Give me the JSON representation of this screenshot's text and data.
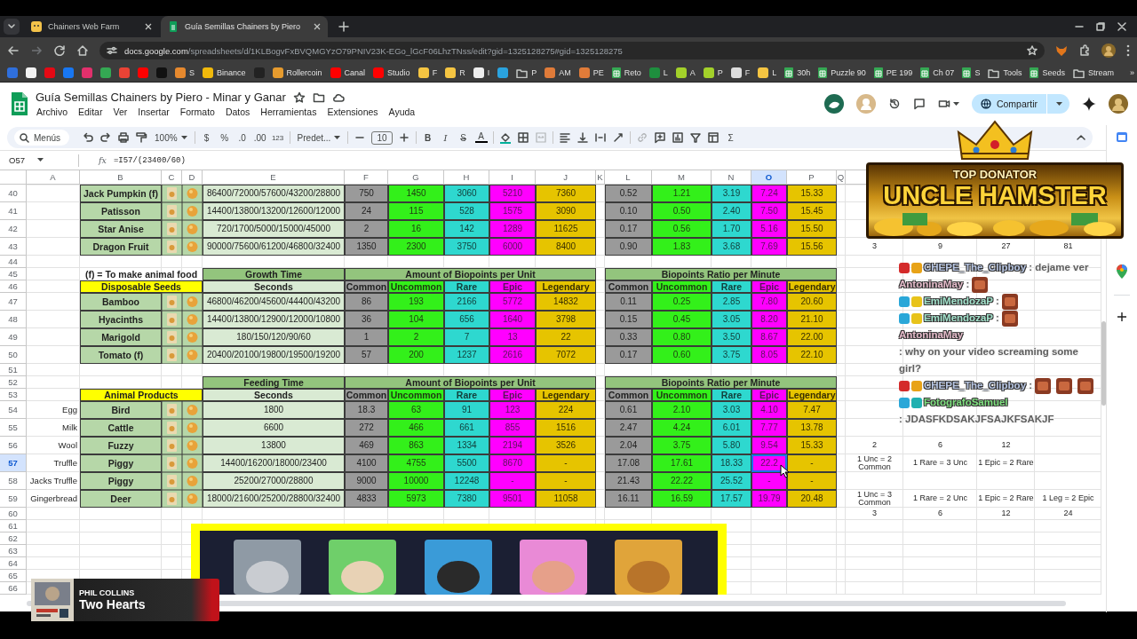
{
  "browser": {
    "tabs": [
      {
        "title": "Chainers Web Farm",
        "selected": false
      },
      {
        "title": "Guía Semillas Chainers by Piero",
        "selected": true
      }
    ],
    "address": {
      "host": "docs.google.com",
      "path": "/spreadsheets/d/1KLBogvFxBVQMGYzO79PNIV23K-EGo_lGcF06LhzTNss/edit?gid=1325128275#gid=1325128275"
    },
    "bookmarks": [
      {
        "kind": "site",
        "color": "#2f6fdc"
      },
      {
        "kind": "site",
        "color": "#f2f2f2"
      },
      {
        "kind": "site",
        "color": "#e50914"
      },
      {
        "kind": "site",
        "color": "#1877f2"
      },
      {
        "kind": "site",
        "color": "#e1306c"
      },
      {
        "kind": "site",
        "color": "#34a853"
      },
      {
        "kind": "site",
        "color": "#ea4335"
      },
      {
        "kind": "site",
        "color": "#ff0000"
      },
      {
        "kind": "site",
        "color": "#111111"
      },
      {
        "kind": "site",
        "color": "#e6892e",
        "label": "S"
      },
      {
        "kind": "site",
        "color": "#f0b90b",
        "label": "Binance"
      },
      {
        "kind": "site",
        "color": "#222222"
      },
      {
        "kind": "site",
        "color": "#e69b2e",
        "label": "Rollercoin"
      },
      {
        "kind": "site",
        "color": "#ff0000",
        "label": "Canal"
      },
      {
        "kind": "site",
        "color": "#ff0000",
        "label": "Studio"
      },
      {
        "kind": "site",
        "color": "#f5c542",
        "label": "F"
      },
      {
        "kind": "site",
        "color": "#f5c542",
        "label": "R"
      },
      {
        "kind": "site",
        "color": "#eeeeee",
        "label": "I"
      },
      {
        "kind": "site",
        "color": "#2aa3df"
      },
      {
        "kind": "folder",
        "label": "P"
      },
      {
        "kind": "site",
        "color": "#e07b39",
        "label": "AM"
      },
      {
        "kind": "site",
        "color": "#e07b39",
        "label": "PE"
      },
      {
        "kind": "sheet",
        "label": "Reto"
      },
      {
        "kind": "site",
        "color": "#1e8e3e",
        "label": "L"
      },
      {
        "kind": "site",
        "color": "#a3d12a",
        "label": "A"
      },
      {
        "kind": "site",
        "color": "#a3d12a",
        "label": "P"
      },
      {
        "kind": "site",
        "color": "#dddddd",
        "label": "F"
      },
      {
        "kind": "site",
        "color": "#f5c542",
        "label": "L"
      },
      {
        "kind": "sheet",
        "label": "30h"
      },
      {
        "kind": "sheet",
        "label": "Puzzle 90"
      },
      {
        "kind": "sheet",
        "label": "PE 199"
      },
      {
        "kind": "sheet",
        "label": "Ch 07"
      },
      {
        "kind": "sheet",
        "label": "S"
      },
      {
        "kind": "folder",
        "label": "Tools"
      },
      {
        "kind": "sheet",
        "label": "Seeds"
      },
      {
        "kind": "folder",
        "label": "Stream"
      }
    ],
    "bookmarks_more": "»"
  },
  "sheet": {
    "title": "Guía Semillas Chainers by Piero - Minar y Ganar",
    "menu": [
      "Archivo",
      "Editar",
      "Ver",
      "Insertar",
      "Formato",
      "Datos",
      "Herramientas",
      "Extensiones",
      "Ayuda"
    ],
    "share": "Compartir",
    "toolbar": {
      "search": "Menús",
      "zoom": "100%",
      "currency": "$",
      "percent": "%",
      "decrease": ".0",
      "increase": ".00",
      "number": "123",
      "font": "Predet...",
      "size": "10",
      "bold": "B",
      "italic": "I",
      "strike": "S",
      "text_color": "A",
      "functions": "Σ"
    },
    "name_box": "O57",
    "fx": "fx",
    "formula": "=I57/(23400/60)"
  },
  "grid": {
    "columns": [
      {
        "label": "A",
        "selected": false
      },
      {
        "label": "B",
        "selected": false
      },
      {
        "label": "C",
        "selected": false
      },
      {
        "label": "D",
        "selected": false
      },
      {
        "label": "E",
        "selected": false
      },
      {
        "label": "F",
        "selected": false
      },
      {
        "label": "G",
        "selected": false
      },
      {
        "label": "H",
        "selected": false
      },
      {
        "label": "I",
        "selected": false
      },
      {
        "label": "J",
        "selected": false
      },
      {
        "label": "K",
        "selected": false
      },
      {
        "label": "L",
        "selected": false
      },
      {
        "label": "M",
        "selected": false
      },
      {
        "label": "N",
        "selected": false
      },
      {
        "label": "O",
        "selected": true
      },
      {
        "label": "P",
        "selected": false
      },
      {
        "label": "Q",
        "selected": false
      }
    ],
    "rows": [
      {
        "number": "40",
        "selected": false,
        "kind": "item",
        "name": "Jack Pumpkin (f)",
        "seconds": "86400/72000/57600/43200/28800",
        "amounts": [
          "750",
          "1450",
          "3060",
          "5210",
          "7360"
        ],
        "ratios": [
          "0.52",
          "1.21",
          "3.19",
          "7.24",
          "15.33"
        ]
      },
      {
        "number": "41",
        "selected": false,
        "kind": "item",
        "name": "Patisson",
        "seconds": "14400/13800/13200/12600/12000",
        "amounts": [
          "24",
          "115",
          "528",
          "1575",
          "3090"
        ],
        "ratios": [
          "0.10",
          "0.50",
          "2.40",
          "7.50",
          "15.45"
        ]
      },
      {
        "number": "42",
        "selected": false,
        "kind": "item",
        "name": "Star Anise",
        "seconds": "720/1700/5000/15000/45000",
        "amounts": [
          "2",
          "16",
          "142",
          "1289",
          "11625"
        ],
        "ratios": [
          "0.17",
          "0.56",
          "1.70",
          "5.16",
          "15.50"
        ]
      },
      {
        "number": "43",
        "selected": false,
        "kind": "item",
        "name": "Dragon Fruit",
        "seconds": "90000/75600/61200/46800/32400",
        "amounts": [
          "1350",
          "2300",
          "3750",
          "6000",
          "8400"
        ],
        "ratios": [
          "0.90",
          "1.83",
          "3.68",
          "7.69",
          "15.56"
        ],
        "notes": [
          "3",
          "9",
          "27",
          "81"
        ]
      },
      {
        "number": "44",
        "selected": false,
        "kind": "blank"
      },
      {
        "number": "45",
        "selected": false,
        "kind": "titles",
        "note": "(f) = To make animal food",
        "time_title": "Growth Time",
        "amount_title": "Amount of Biopoints per Unit",
        "ratio_title": "Biopoints Ratio per Minute"
      },
      {
        "number": "46",
        "selected": false,
        "kind": "heads",
        "group": "Disposable Seeds",
        "time_head": "Seconds",
        "amount_heads": [
          "Common",
          "Uncommon",
          "Rare",
          "Epic",
          "Legendary"
        ],
        "ratio_heads": [
          "Common",
          "Uncommon",
          "Rare",
          "Epic",
          "Legendary"
        ]
      },
      {
        "number": "47",
        "selected": false,
        "kind": "item",
        "name": "Bamboo",
        "seconds": "46800/46200/45600/44400/43200",
        "amounts": [
          "86",
          "193",
          "2166",
          "5772",
          "14832"
        ],
        "ratios": [
          "0.11",
          "0.25",
          "2.85",
          "7.80",
          "20.60"
        ]
      },
      {
        "number": "48",
        "selected": false,
        "kind": "item",
        "name": "Hyacinths",
        "seconds": "14400/13800/12900/12000/10800",
        "amounts": [
          "36",
          "104",
          "656",
          "1640",
          "3798"
        ],
        "ratios": [
          "0.15",
          "0.45",
          "3.05",
          "8.20",
          "21.10"
        ]
      },
      {
        "number": "49",
        "selected": false,
        "kind": "item",
        "name": "Marigold",
        "seconds": "180/150/120/90/60",
        "amounts": [
          "1",
          "2",
          "7",
          "13",
          "22"
        ],
        "ratios": [
          "0.33",
          "0.80",
          "3.50",
          "8.67",
          "22.00"
        ]
      },
      {
        "number": "50",
        "selected": false,
        "kind": "item",
        "name": "Tomato (f)",
        "seconds": "20400/20100/19800/19500/19200",
        "amounts": [
          "57",
          "200",
          "1237",
          "2616",
          "7072"
        ],
        "ratios": [
          "0.17",
          "0.60",
          "3.75",
          "8.05",
          "22.10"
        ]
      },
      {
        "number": "51",
        "selected": false,
        "kind": "blank"
      },
      {
        "number": "52",
        "selected": false,
        "kind": "titles",
        "time_title": "Feeding Time",
        "amount_title": "Amount of Biopoints per Unit",
        "ratio_title": "Biopoints Ratio per Minute"
      },
      {
        "number": "53",
        "selected": false,
        "kind": "heads",
        "group": "Animal Products",
        "time_head": "Seconds",
        "amount_heads": [
          "Common",
          "Uncommon",
          "Rare",
          "Epic",
          "Legendary"
        ],
        "ratio_heads": [
          "Common",
          "Uncommon",
          "Rare",
          "Epic",
          "Legendary"
        ]
      },
      {
        "number": "54",
        "selected": false,
        "kind": "item",
        "product": "Egg",
        "name": "Bird",
        "seconds": "1800",
        "amounts": [
          "18.3",
          "63",
          "91",
          "123",
          "224"
        ],
        "ratios": [
          "0.61",
          "2.10",
          "3.03",
          "4.10",
          "7.47"
        ]
      },
      {
        "number": "55",
        "selected": false,
        "kind": "item",
        "product": "Milk",
        "name": "Cattle",
        "seconds": "6600",
        "amounts": [
          "272",
          "466",
          "661",
          "855",
          "1516"
        ],
        "ratios": [
          "2.47",
          "4.24",
          "6.01",
          "7.77",
          "13.78"
        ]
      },
      {
        "number": "56",
        "selected": false,
        "kind": "item",
        "product": "Wool",
        "name": "Fuzzy",
        "seconds": "13800",
        "amounts": [
          "469",
          "863",
          "1334",
          "2194",
          "3526"
        ],
        "ratios": [
          "2.04",
          "3.75",
          "5.80",
          "9.54",
          "15.33"
        ],
        "notes": [
          "2",
          "6",
          "12"
        ]
      },
      {
        "number": "57",
        "selected": true,
        "kind": "item",
        "product": "Truffle",
        "name": "Piggy",
        "seconds": "14400/16200/18000/23400",
        "amounts": [
          "4100",
          "4755",
          "5500",
          "8670",
          "-"
        ],
        "ratios": [
          "17.08",
          "17.61",
          "18.33",
          "22.2",
          "-"
        ],
        "notes": [
          "1 Unc = 2 Common",
          "1 Rare = 3 Unc",
          "1 Epic = 2 Rare"
        ]
      },
      {
        "number": "58",
        "selected": false,
        "kind": "item",
        "product": "Jacks Truffle",
        "name": "Piggy",
        "seconds": "25200/27000/28800",
        "amounts": [
          "9000",
          "10000",
          "12248",
          "-",
          "-"
        ],
        "ratios": [
          "21.43",
          "22.22",
          "25.52",
          "-",
          "-"
        ]
      },
      {
        "number": "59",
        "selected": false,
        "kind": "item",
        "product": "Gingerbread",
        "name": "Deer",
        "seconds": "18000/21600/25200/28800/32400",
        "amounts": [
          "4833",
          "5973",
          "7380",
          "9501",
          "11058"
        ],
        "ratios": [
          "16.11",
          "16.59",
          "17.57",
          "19.79",
          "20.48"
        ],
        "notes": [
          "1 Unc = 3 Common",
          "1 Rare = 2 Unc",
          "1 Epic = 2 Rare",
          "1 Leg = 2 Epic"
        ]
      },
      {
        "number": "60",
        "selected": false,
        "kind": "blank",
        "notes": [
          "3",
          "6",
          "12",
          "24"
        ]
      },
      {
        "number": "61",
        "selected": false,
        "kind": "blank"
      },
      {
        "number": "62",
        "selected": false,
        "kind": "blank"
      },
      {
        "number": "63",
        "selected": false,
        "kind": "blank"
      },
      {
        "number": "64",
        "selected": false,
        "kind": "blank"
      },
      {
        "number": "65",
        "selected": false,
        "kind": "blank"
      },
      {
        "number": "66",
        "selected": false,
        "kind": "blank"
      }
    ],
    "image": {
      "kind": "picture"
    }
  },
  "donor": {
    "title": "TOP DONATOR",
    "name": "UNCLE HAMSTER"
  },
  "chat": [
    {
      "user": "CHEPE_The_Clipboy",
      "color": "#b9c7e4",
      "badges": [
        {
          "color": "#d42a2a"
        },
        {
          "color": "#e8a317"
        }
      ],
      "text": ": dejame ver"
    },
    {
      "user": "AntoninaMay",
      "color": "#e6bccb",
      "text": ":",
      "emotes": [
        {
          "kind": "picture"
        }
      ]
    },
    {
      "user": "EmiMendozaP",
      "color": "#a3e3cc",
      "badges": [
        {
          "color": "#2aa7d8"
        },
        {
          "color": "#e8c31a"
        }
      ],
      "text": ":",
      "emotes": [
        {
          "kind": "picture"
        }
      ]
    },
    {
      "user": "EmiMendozaP",
      "color": "#a3e3cc",
      "badges": [
        {
          "color": "#2aa7d8"
        },
        {
          "color": "#e8c31a"
        }
      ],
      "text": ":",
      "emotes": [
        {
          "kind": "picture"
        }
      ]
    },
    {
      "user": "AntoninaMay",
      "color": "#e6bccb",
      "text": ": why on your video screaming some girl?"
    },
    {
      "user": "CHEPE_The_Clipboy",
      "color": "#b9c7e4",
      "badges": [
        {
          "color": "#d42a2a"
        },
        {
          "color": "#e8a317"
        }
      ],
      "text": ":",
      "emotes": [
        {
          "kind": "picture"
        },
        {
          "kind": "picture"
        },
        {
          "kind": "picture"
        }
      ]
    },
    {
      "user": "FotografoSamuel",
      "color": "#7fe07f",
      "badges": [
        {
          "color": "#2aa7d8"
        },
        {
          "color": "#20b0b0"
        }
      ],
      "text": ": JDASFKDSAKJFSAJKFSAKJF"
    }
  ],
  "now_playing": {
    "artist": "PHIL COLLINS",
    "title": "Two Hearts"
  }
}
